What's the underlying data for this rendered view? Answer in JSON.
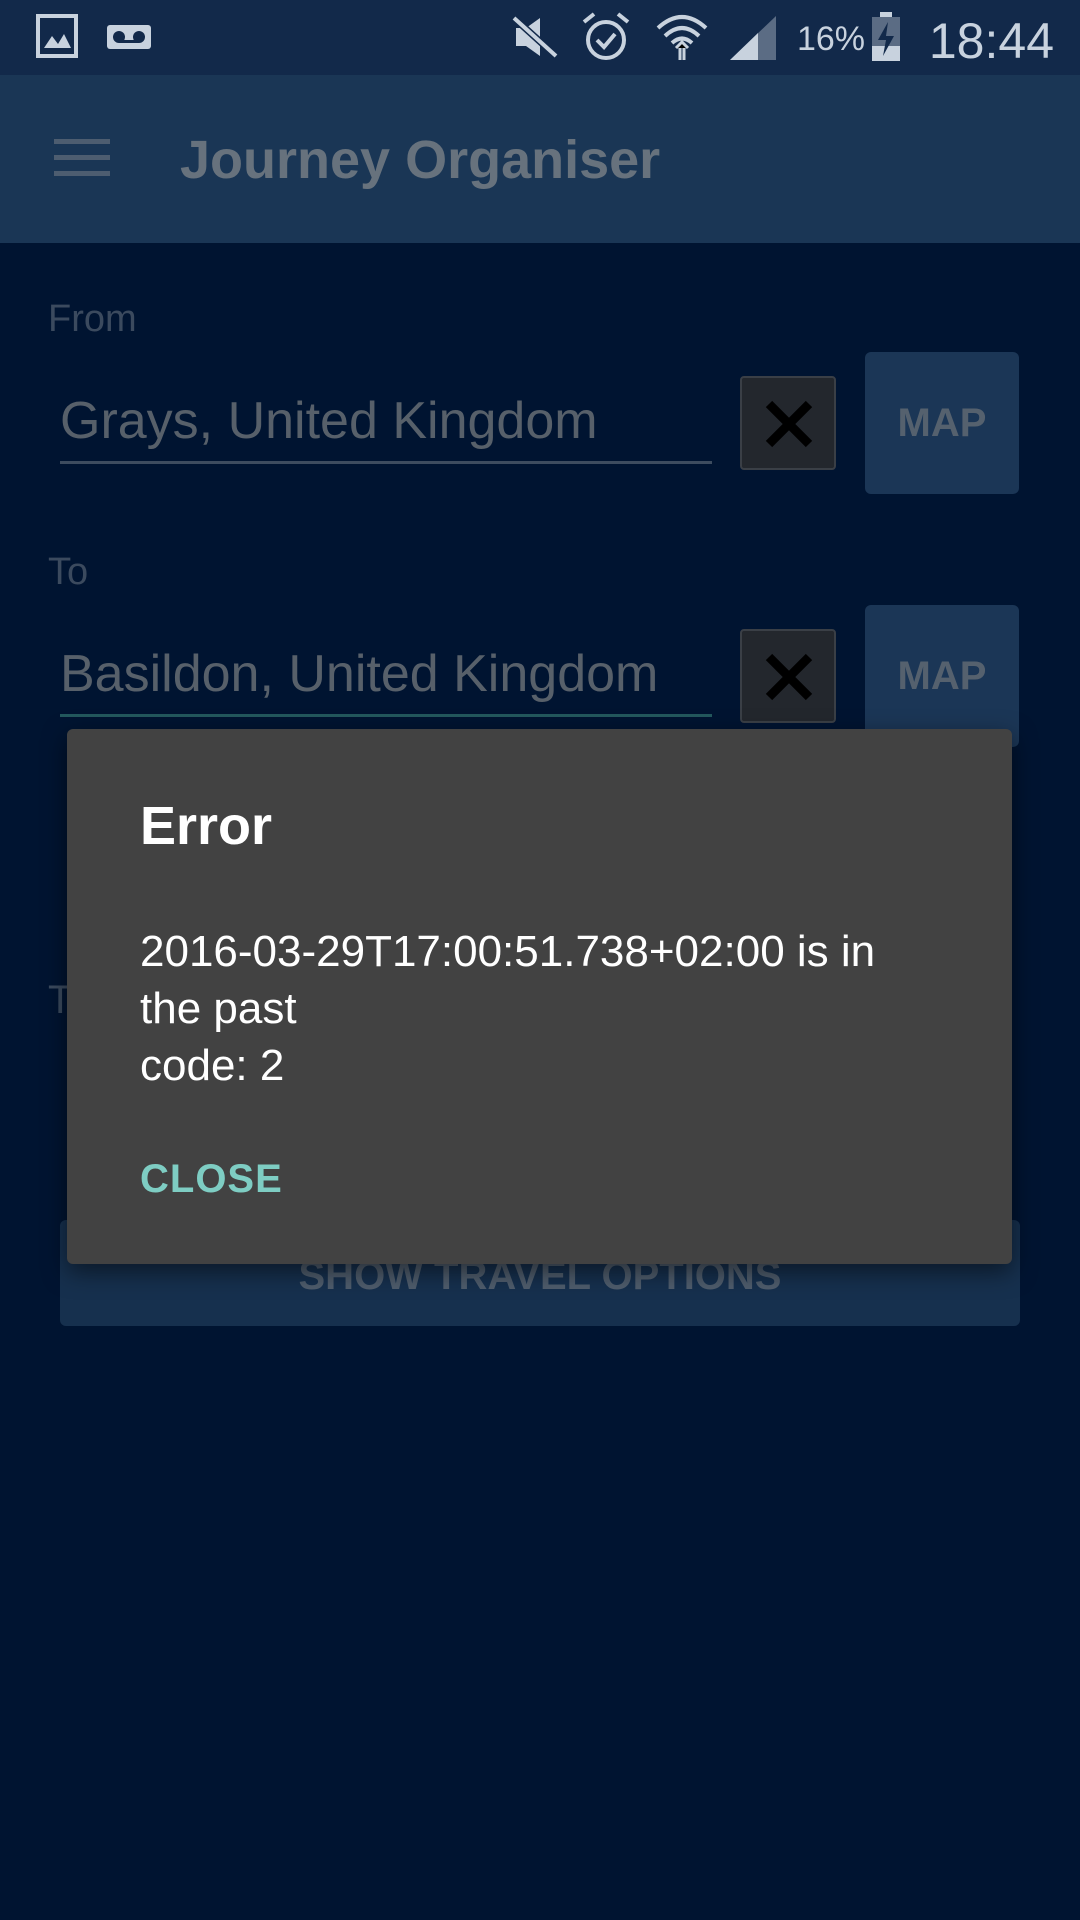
{
  "status_bar": {
    "icons": [
      "image-icon",
      "voicemail-icon",
      "mute-icon",
      "alarm-icon",
      "wifi-icon",
      "signal-icon",
      "battery-charging-icon"
    ],
    "battery_percent": "16%",
    "time": "18:44"
  },
  "app_bar": {
    "menu_icon": "menu-icon",
    "title": "Journey Organiser"
  },
  "form": {
    "from": {
      "label": "From",
      "value": "Grays, United Kingdom",
      "clear_icon": "close-icon",
      "map_label": "MAP"
    },
    "to": {
      "label": "To",
      "value": "Basildon, United Kingdom",
      "clear_icon": "close-icon",
      "map_label": "MAP"
    },
    "time_label_partial": "T",
    "show_options_label": "SHOW TRAVEL OPTIONS"
  },
  "dialog": {
    "title": "Error",
    "message_lines": [
      "2016-03-29T17:00:51.738+02:00 is in",
      "the past",
      "code: 2"
    ],
    "close_label": "CLOSE"
  },
  "colors": {
    "background": "#001431",
    "status_bar": "#12294a",
    "app_bar": "#1a3655",
    "dialog": "#424242",
    "accent": "#7ecdc3"
  }
}
